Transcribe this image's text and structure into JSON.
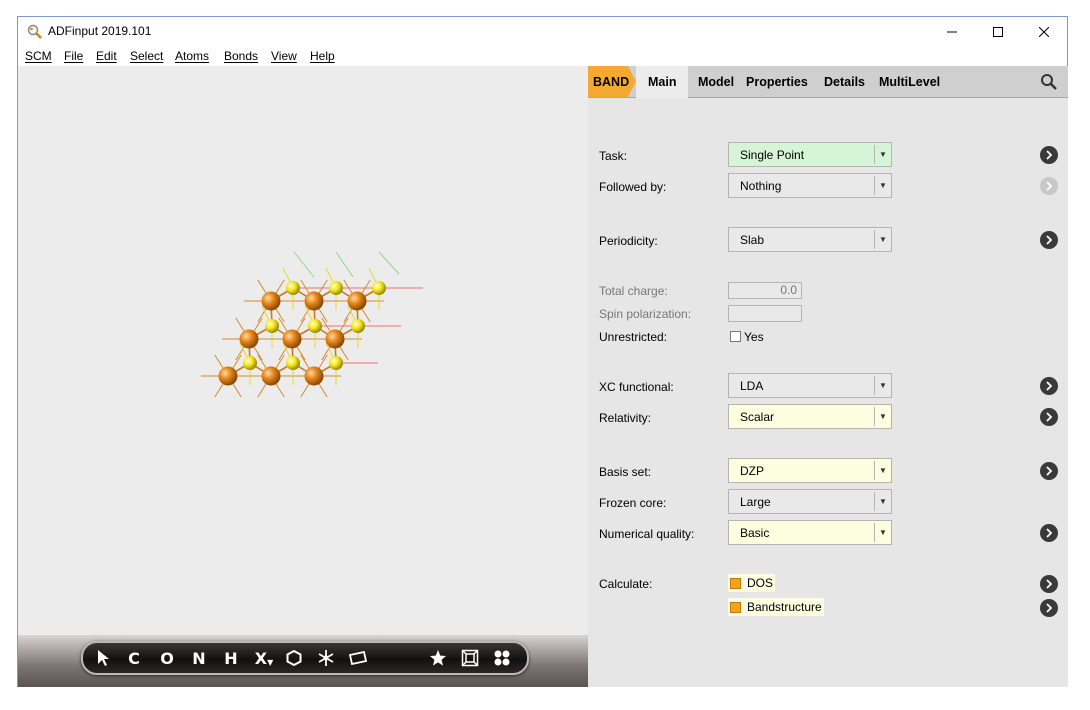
{
  "window": {
    "title": "ADFinput 2019.101"
  },
  "menu": [
    "SCM",
    "File",
    "Edit",
    "Select",
    "Atoms",
    "Bonds",
    "View",
    "Help"
  ],
  "toolbar": {
    "tools": [
      "select-arrow",
      "C",
      "O",
      "N",
      "H",
      "X",
      "ring",
      "snowflake",
      "plane",
      "star",
      "box",
      "grid"
    ],
    "labels": {
      "c": "C",
      "o": "O",
      "n": "N",
      "h": "H",
      "x": "X"
    }
  },
  "tabs": {
    "band": "BAND",
    "main": "Main",
    "model": "Model",
    "properties": "Properties",
    "details": "Details",
    "multilevel": "MultiLevel"
  },
  "form": {
    "task": {
      "label": "Task:",
      "value": "Single Point"
    },
    "followed_by": {
      "label": "Followed by:",
      "value": "Nothing"
    },
    "periodicity": {
      "label": "Periodicity:",
      "value": "Slab"
    },
    "total_charge": {
      "label": "Total charge:",
      "value": "0.0"
    },
    "spin_polarization": {
      "label": "Spin polarization:",
      "value": ""
    },
    "unrestricted": {
      "label": "Unrestricted:",
      "option": "Yes",
      "checked": false
    },
    "xc_functional": {
      "label": "XC functional:",
      "value": "LDA"
    },
    "relativity": {
      "label": "Relativity:",
      "value": "Scalar"
    },
    "basis_set": {
      "label": "Basis set:",
      "value": "DZP"
    },
    "frozen_core": {
      "label": "Frozen core:",
      "value": "Large"
    },
    "numerical_quality": {
      "label": "Numerical quality:",
      "value": "Basic"
    },
    "calculate": {
      "label": "Calculate:",
      "options": [
        "DOS",
        "Bandstructure"
      ]
    }
  },
  "colors": {
    "band_tab": "#f5a933",
    "task_field": "#d6f5d6",
    "highlight_field": "#fdfde0",
    "atom_large": "#e8871c",
    "atom_small": "#f5e61a"
  }
}
